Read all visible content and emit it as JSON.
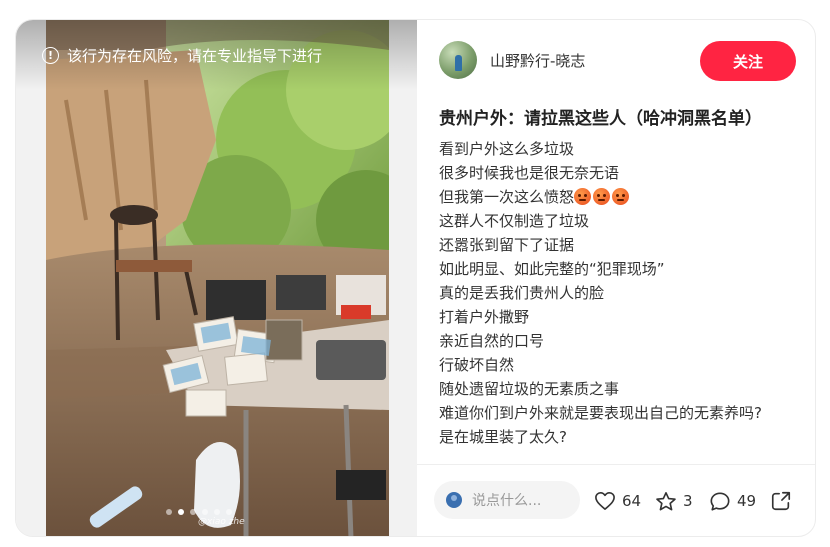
{
  "media": {
    "warning_text": "该行为存在风险，请在专业指导下进行",
    "watermark": "@xiao zhe",
    "carousel": {
      "count": 6,
      "active_index": 1
    }
  },
  "author": {
    "name": "山野黔行-晓志",
    "follow_label": "关注"
  },
  "post": {
    "title": "贵州户外：请拉黑这些人（哈冲洞黑名单）",
    "lines": [
      "看到户外这么多垃圾",
      "很多时候我也是很无奈无语",
      "但我第一次这么愤怒",
      "这群人不仅制造了垃圾",
      "还嚣张到留下了证据",
      "如此明显、如此完整的“犯罪现场”",
      "真的是丢我们贵州人的脸",
      "打着户外撒野",
      "亲近自然的口号",
      "行破坏自然",
      "随处遗留垃圾的无素质之事",
      "难道你们到户外来就是要表现出自己的无素养吗?",
      "是在城里装了太久?"
    ],
    "angry_emoji_count": 3
  },
  "actions": {
    "comment_placeholder": "说点什么...",
    "likes": "64",
    "stars": "3",
    "comments": "49"
  },
  "colors": {
    "accent": "#ff2442",
    "text": "#333333",
    "muted": "#999999"
  },
  "icons": [
    "warning-icon",
    "heart-icon",
    "star-icon",
    "comment-icon",
    "share-icon",
    "angry-emoji-icon"
  ]
}
